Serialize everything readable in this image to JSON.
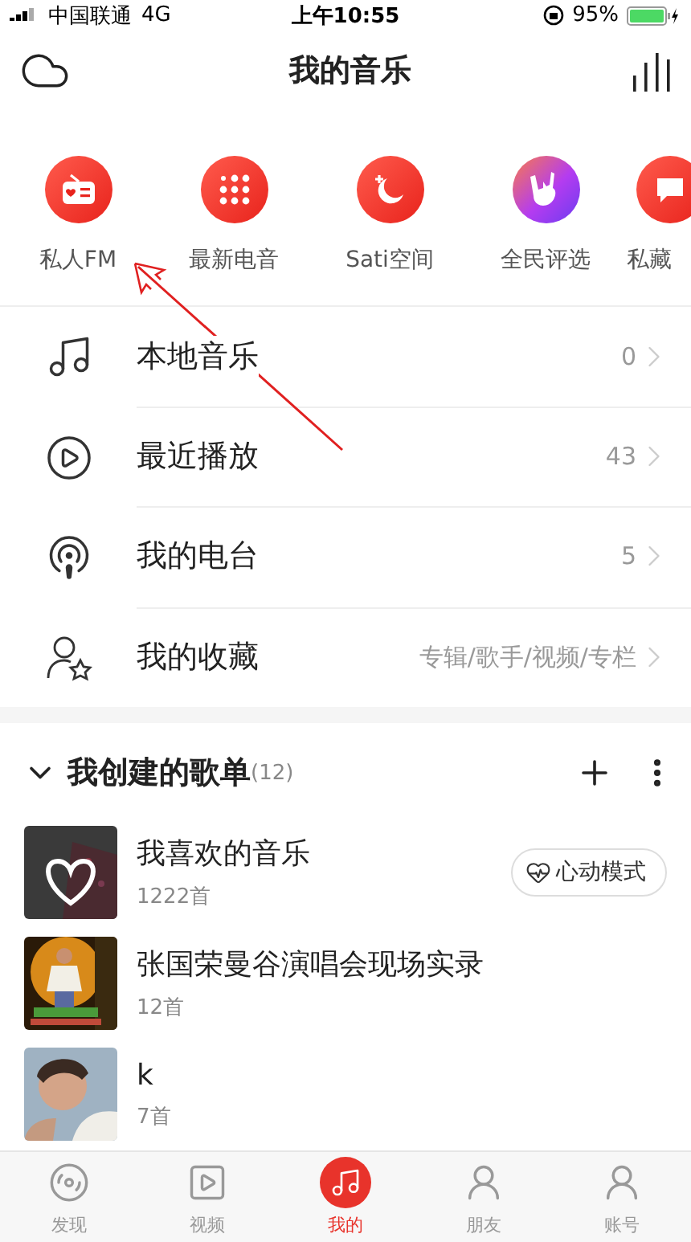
{
  "status_bar": {
    "carrier": "中国联通",
    "network": "4G",
    "time": "上午10:55",
    "battery": "95%"
  },
  "header": {
    "title": "我的音乐"
  },
  "shortcuts": [
    {
      "label": "私人FM"
    },
    {
      "label": "最新电音"
    },
    {
      "label": "Sati空间"
    },
    {
      "label": "全民评选"
    },
    {
      "label": "私藏"
    }
  ],
  "menu": [
    {
      "label": "本地音乐",
      "value": "0"
    },
    {
      "label": "最近播放",
      "value": "43"
    },
    {
      "label": "我的电台",
      "value": "5"
    },
    {
      "label": "我的收藏",
      "value": "专辑/歌手/视频/专栏"
    }
  ],
  "playlists_section": {
    "title": "我创建的歌单",
    "count": "(12)",
    "expanded": true,
    "items": [
      {
        "name": "我喜欢的音乐",
        "tracks": "1222首",
        "action": "心动模式"
      },
      {
        "name": "张国荣曼谷演唱会现场实录",
        "tracks": "12首"
      },
      {
        "name": "k",
        "tracks": "7首"
      }
    ]
  },
  "tab_bar": [
    {
      "label": "发现",
      "selected": false
    },
    {
      "label": "视频",
      "selected": false
    },
    {
      "label": "我的",
      "selected": true
    },
    {
      "label": "朋友",
      "selected": false
    },
    {
      "label": "账号",
      "selected": false
    }
  ]
}
